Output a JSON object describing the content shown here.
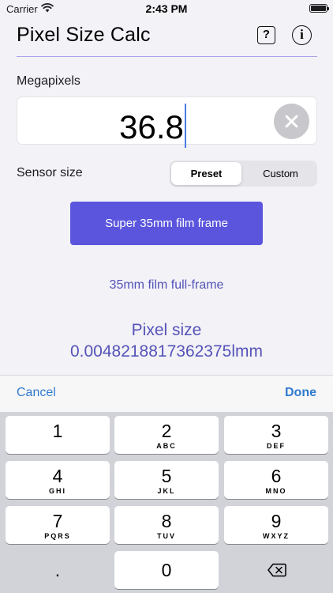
{
  "status_bar": {
    "carrier": "Carrier",
    "time": "2:43 PM",
    "wifi_icon": "wifi-icon",
    "battery_icon": "battery-full-icon"
  },
  "nav": {
    "title": "Pixel Size Calc",
    "help_label": "?",
    "info_label": "i",
    "help_icon": "question-box-icon",
    "info_icon": "info-circle-icon"
  },
  "megapixels": {
    "label": "Megapixels",
    "value": "36.8",
    "clear_icon": "clear-circle-icon"
  },
  "sensor": {
    "label": "Sensor size",
    "options": [
      "Preset",
      "Custom"
    ],
    "selected": "Preset",
    "preset_button": "Super 35mm film frame",
    "description": "35mm film full-frame"
  },
  "result": {
    "title": "Pixel size",
    "value": "0.0048218817362375lmm"
  },
  "accessory": {
    "cancel": "Cancel",
    "done": "Done"
  },
  "keyboard": {
    "keys": [
      {
        "digit": "1",
        "letters": ""
      },
      {
        "digit": "2",
        "letters": "ABC"
      },
      {
        "digit": "3",
        "letters": "DEF"
      },
      {
        "digit": "4",
        "letters": "GHI"
      },
      {
        "digit": "5",
        "letters": "JKL"
      },
      {
        "digit": "6",
        "letters": "MNO"
      },
      {
        "digit": "7",
        "letters": "PQRS"
      },
      {
        "digit": "8",
        "letters": "TUV"
      },
      {
        "digit": "9",
        "letters": "WXYZ"
      },
      {
        "digit": "0",
        "letters": ""
      }
    ],
    "decimal": ".",
    "backspace_icon": "backspace-icon"
  },
  "colors": {
    "accent": "#5a55dc",
    "result_text": "#5553b8",
    "link": "#2f7ad0",
    "background": "#f2f2f7"
  }
}
